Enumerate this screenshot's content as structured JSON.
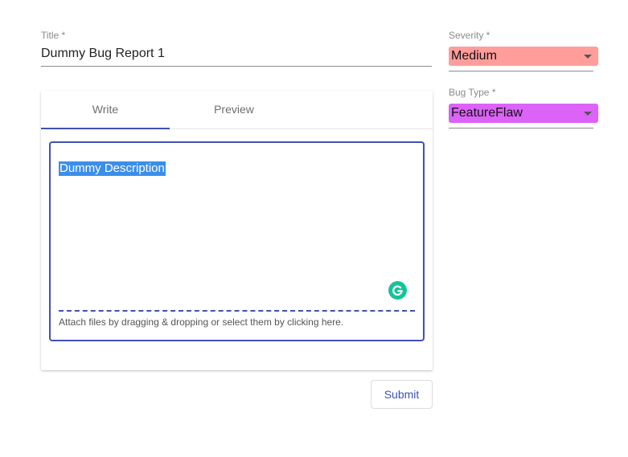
{
  "title_field": {
    "label": "Title *",
    "value": "Dummy Bug Report 1"
  },
  "editor": {
    "tabs": [
      {
        "label": "Write",
        "active": true
      },
      {
        "label": "Preview",
        "active": false
      }
    ],
    "content": "Dummy Description",
    "attach_hint": "Attach files by dragging & dropping or select them by clicking here.",
    "grammarly_icon": "grammarly-icon"
  },
  "submit_label": "Submit",
  "severity": {
    "label": "Severity *",
    "value": "Medium",
    "color": "#ff9d9b"
  },
  "bug_type": {
    "label": "Bug Type *",
    "value": "FeatureFlaw",
    "color": "#dc62f8"
  },
  "colors": {
    "accent": "#3f51b5",
    "selection": "#3b8eea",
    "grammarly": "#15c39a"
  }
}
